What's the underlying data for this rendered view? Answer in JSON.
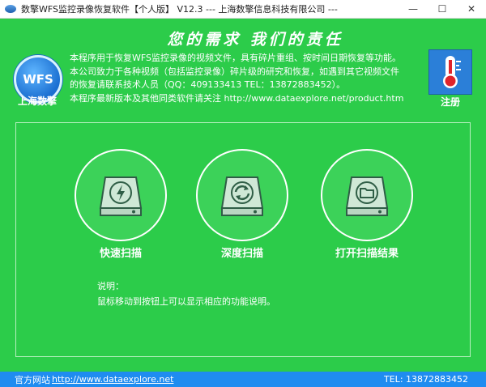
{
  "window": {
    "title": "数擎WFS监控录像恢复软件【个人版】 V12.3  --- 上海数擎信息科技有限公司 ---",
    "minimize": "—",
    "maximize": "☐",
    "close": "✕"
  },
  "header": {
    "slogan": "您的需求  我们的责任",
    "logo_text": "WFS",
    "company": "上海数擎",
    "description": [
      "本程序用于恢复WFS监控录像的视频文件，具有碎片重组、按时间日期恢复等功能。",
      "本公司致力于各种视频（包括监控录像）碎片级的研究和恢复，如遇到其它视频文件",
      "的恢复请联系技术人员（QQ：409133413  TEL：13872883452）。",
      "本程序最新版本及其他同类软件请关注 http://www.dataexplore.net/product.htm"
    ],
    "register_label": "注册"
  },
  "actions": {
    "quick_scan": "快速扫描",
    "deep_scan": "深度扫描",
    "open_results": "打开扫描结果"
  },
  "notes": {
    "title": "说明：",
    "text": "鼠标移动到按钮上可以显示相应的功能说明。"
  },
  "statusbar": {
    "site_label": "官方网站",
    "site_url": "http://www.dataexplore.net",
    "tel": "TEL: 13872883452"
  },
  "icons": [
    "app-icon",
    "wfs-logo",
    "thermometer-key-icon",
    "lightning-icon",
    "refresh-icon",
    "folder-icon"
  ],
  "colors": {
    "background": "#2ccc4a",
    "circle": "#3cd259",
    "statusbar": "#1f8cf0",
    "register": "#2b7fd8"
  }
}
